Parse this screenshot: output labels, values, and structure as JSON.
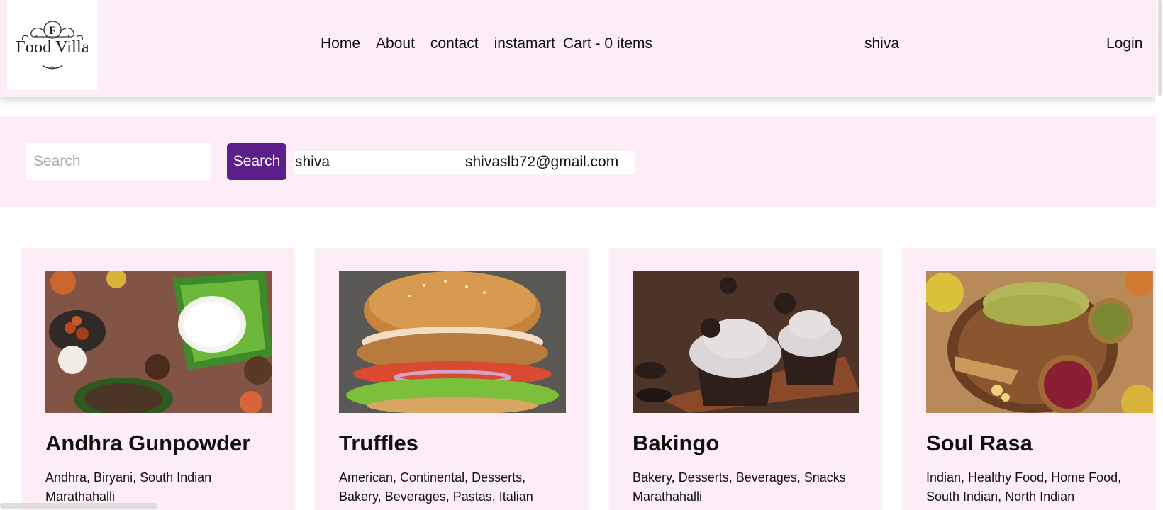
{
  "header": {
    "logo_letter": "F",
    "logo_text": "Food Villa",
    "nav": [
      {
        "label": "Home"
      },
      {
        "label": "About"
      },
      {
        "label": "contact"
      },
      {
        "label": "instamart"
      },
      {
        "label": "Cart - 0 items"
      }
    ],
    "user_name": "shiva",
    "login_label": "Login"
  },
  "search": {
    "placeholder": "Search",
    "value": "",
    "button_label": "Search",
    "user_name": "shiva",
    "user_email": "shivaslb72@gmail.com"
  },
  "restaurants": [
    {
      "name": "Andhra Gunpowder",
      "cuisines": "Andhra, Biryani, South Indian",
      "area": "Marathahalli"
    },
    {
      "name": "Truffles",
      "cuisines": "American, Continental, Desserts,",
      "area": "Bakery, Beverages, Pastas, Italian"
    },
    {
      "name": "Bakingo",
      "cuisines": "Bakery, Desserts, Beverages, Snacks",
      "area": "Marathahalli"
    },
    {
      "name": "Soul Rasa",
      "cuisines": "Indian, Healthy Food, Home Food,",
      "area": "South Indian, North Indian"
    }
  ],
  "colors": {
    "header_bg": "#fcedf6",
    "search_button": "#5b1e8a",
    "card_bg": "#fcedf6"
  }
}
